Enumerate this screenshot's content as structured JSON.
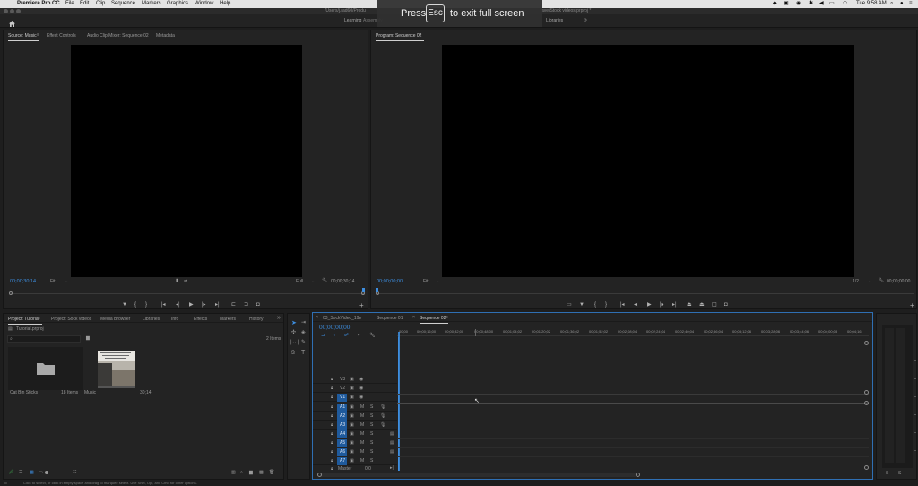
{
  "menubar": {
    "apple": "",
    "app_name": "Premiere Pro CC",
    "menus": [
      "File",
      "Edit",
      "Clip",
      "Sequence",
      "Markers",
      "Graphics",
      "Window",
      "Help"
    ],
    "clock": "Tue 9:58 AM"
  },
  "title_bar": {
    "path_left": "/Users/j.rad60/Produ",
    "path_right": "ave/Stock videos.prproj *"
  },
  "workspaces": {
    "visible": [
      "Learning",
      "Assembly",
      "Libraries"
    ],
    "overflow": "»"
  },
  "fullscreen_hint": {
    "press": "Press",
    "key": "Esc",
    "rest": "to exit full screen"
  },
  "source_panel": {
    "tabs": [
      "Source: Music",
      "Effect Controls",
      "Audio Clip Mixer: Sequence 02",
      "Metadata"
    ],
    "timecode_left": "00;00;30;14",
    "fit": "Fit",
    "full": "Full",
    "timecode_right": "00;00;30;14"
  },
  "program_panel": {
    "tab": "Program: Sequence 02",
    "timecode_left": "00;00;00;00",
    "fit": "Fit",
    "zoom": "1/2",
    "timecode_right": "00;00;00;00"
  },
  "project_panel": {
    "tabs": [
      "Project: Tutorial",
      "Project: Sock videos",
      "Media Browser",
      "Libraries",
      "Info",
      "Effects",
      "Markers",
      "History"
    ],
    "overflow": "»",
    "file_name": "Tutorial.prproj",
    "item_count": "2 Items",
    "items": [
      {
        "name": "Cat Bin Sticks",
        "meta": "18 Items"
      },
      {
        "name": "Music",
        "meta": "30;14"
      }
    ]
  },
  "timeline": {
    "tabs": [
      "03_SockVideo_19e",
      "Sequence 01",
      "Sequence 02"
    ],
    "timecode": "00;00;00;00",
    "ruler": [
      "00;00",
      "00;00;16;00",
      "00;00;32;00",
      "00;00;48;00",
      "00;01;04;02",
      "00;01;20;02",
      "00;01;36;02",
      "00;01;52;02",
      "00;02;08;04",
      "00;02;24;04",
      "00;02;40;04",
      "00;02;56;04",
      "00;03;12;06",
      "00;03;28;06",
      "00;03;44;06",
      "00;04;00;08",
      "00;04;16"
    ],
    "video_tracks": [
      "V3",
      "V2",
      "V1"
    ],
    "audio_tracks": [
      "A1",
      "A2",
      "A3",
      "A4",
      "A5",
      "A6",
      "A7"
    ],
    "track_buttons": {
      "mute": "M",
      "solo": "S"
    },
    "master_label": "Master",
    "master_value": "0.0"
  },
  "status_bar": {
    "text": "Click to select, or click in empty space and drag to marquee select. Use Shift, Opt, and Cmd for other options."
  },
  "colors": {
    "accent": "#3d8ee0",
    "panel_bg": "#232323",
    "track_blue": "#1f5a9c"
  }
}
